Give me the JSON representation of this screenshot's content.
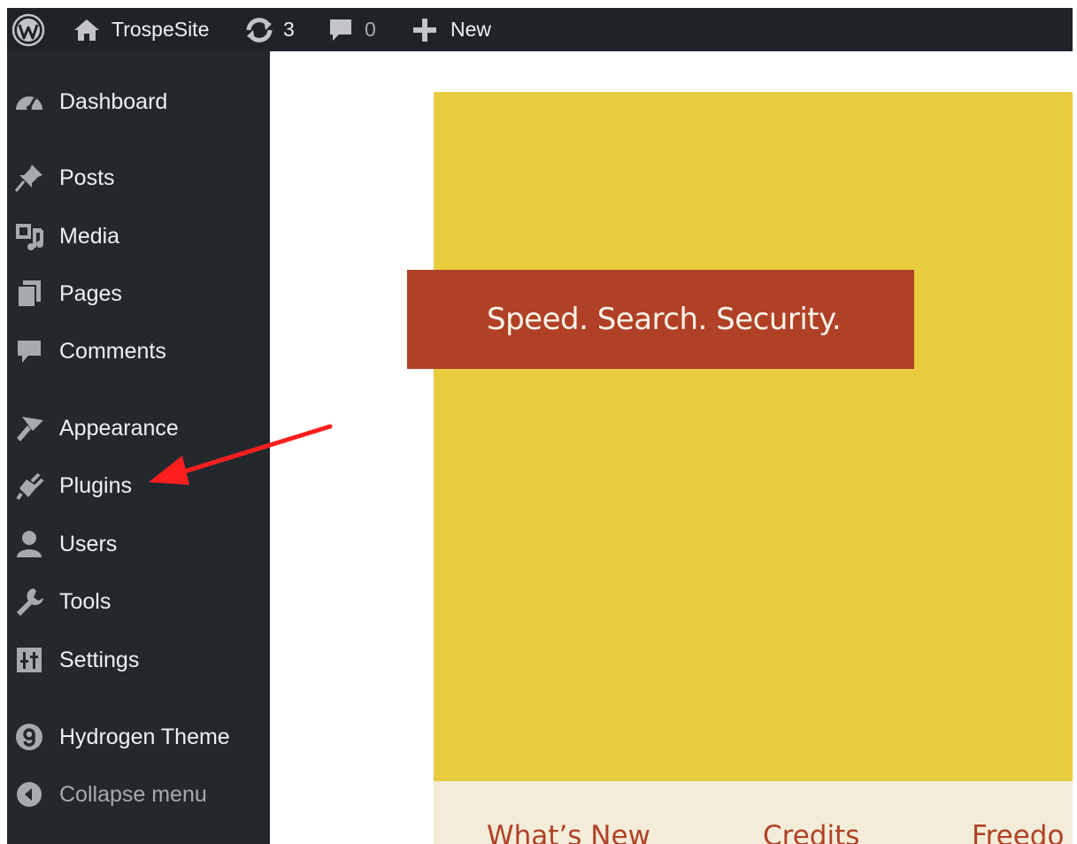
{
  "admin_bar": {
    "wp_logo_icon": "wordpress-logo-icon",
    "site_name": "TrospeSite",
    "updates_count": "3",
    "comments_count": "0",
    "new_label": "New"
  },
  "sidebar": {
    "items": [
      {
        "label": "Dashboard",
        "icon": "dashboard-icon"
      },
      {
        "label": "Posts",
        "icon": "pin-icon"
      },
      {
        "label": "Media",
        "icon": "media-icon"
      },
      {
        "label": "Pages",
        "icon": "pages-icon"
      },
      {
        "label": "Comments",
        "icon": "comment-icon"
      },
      {
        "label": "Appearance",
        "icon": "brush-icon"
      },
      {
        "label": "Plugins",
        "icon": "plug-icon"
      },
      {
        "label": "Users",
        "icon": "user-icon"
      },
      {
        "label": "Tools",
        "icon": "wrench-icon"
      },
      {
        "label": "Settings",
        "icon": "settings-icon"
      },
      {
        "label": "Hydrogen Theme",
        "icon": "hydrogen-icon"
      },
      {
        "label": "Collapse menu",
        "icon": "collapse-icon"
      }
    ]
  },
  "main": {
    "banner_text": "Speed. Search. Security.",
    "tabs": [
      {
        "label": "What’s New"
      },
      {
        "label": "Credits"
      },
      {
        "label": "Freedo"
      }
    ]
  },
  "colors": {
    "admin_bar": "#1d2327",
    "sidebar": "#23282d",
    "hero_yellow": "#e9cc3e",
    "banner_red": "#b04126",
    "tabs_bg": "#f3ecd8",
    "annotation_arrow": "#ff1e1e"
  }
}
